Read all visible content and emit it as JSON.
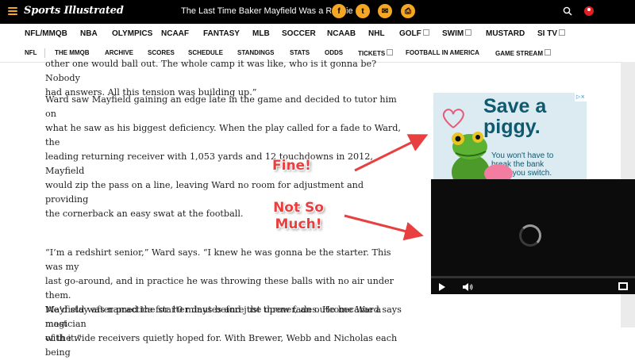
{
  "topbar": {
    "logo": "Sports Illustrated",
    "headline": "The Last Time Baker Mayfield Was a Rookie",
    "share_icons": [
      "facebook-icon",
      "twitter-icon",
      "email-icon",
      "print-icon"
    ],
    "share_glyphs": [
      "f",
      "t",
      "✉",
      "⎙"
    ]
  },
  "nav_primary": [
    {
      "label": "NFL/MMQB"
    },
    {
      "label": "NBA"
    },
    {
      "label": "OLYMPICS"
    },
    {
      "label": "NCAAF"
    },
    {
      "label": "FANTASY"
    },
    {
      "label": "MLB"
    },
    {
      "label": "SOCCER"
    },
    {
      "label": "NCAAB"
    },
    {
      "label": "NHL"
    },
    {
      "label": "GOLF"
    },
    {
      "label": "SWIM"
    },
    {
      "label": "MUSTARD"
    },
    {
      "label": "SI TV"
    }
  ],
  "nav_secondary": [
    {
      "label": "NFL"
    },
    {
      "label": "THE MMQB"
    },
    {
      "label": "ARCHIVE"
    },
    {
      "label": "SCORES"
    },
    {
      "label": "SCHEDULE"
    },
    {
      "label": "STANDINGS"
    },
    {
      "label": "STATS"
    },
    {
      "label": "ODDS"
    },
    {
      "label": "TICKETS"
    },
    {
      "label": "FOOTBALL IN AMERICA"
    },
    {
      "label": "GAME STREAM"
    }
  ],
  "article": {
    "p0_lines": [
      "other one would ball out. The whole camp it was like, who is it gonna be? Nobody",
      "had answers. All this tension was building up.”"
    ],
    "p1_lines": [
      "Ward saw Mayfield gaining an edge late in the game and decided to tutor him on",
      "what he saw as his biggest deficiency. When the play called for a fade to Ward, the",
      "leading returning receiver with 1,053 yards and 12 touchdowns in 2012, Mayfield",
      "would zip the pass on a line, leaving Ward no room for adjustment and providing",
      "the cornerback an easy swat at the football."
    ],
    "p2_lines": [
      "“I’m a redshirt senior,” Ward says. “I knew he was gonna be the starter. This was my",
      "last go-around, and in practice he was throwing these balls with no air under them.",
      "We’d stay after practice for 10 minutes and just throw fades. He became a magician",
      "with it.”"
    ],
    "p3_lines": [
      "Mayfield was named the starter days before the opener, an outcome Ward says most",
      "of the wide receivers quietly hoped for. With Brewer, Webb and Nicholas each being"
    ]
  },
  "ad": {
    "title_line1": "Save a",
    "title_line2": "piggy.",
    "sub_lines": [
      "You won't have to",
      "break the bank",
      "when you switch."
    ],
    "adchoices_label": "▷×"
  },
  "video_player": {
    "state": "loading"
  },
  "annotations": {
    "fine": "Fine!",
    "not_so": "Not So",
    "much": "Much!"
  },
  "colors": {
    "accent": "#f5a623",
    "annotation_red": "#e84040",
    "ad_teal": "#0d5a70"
  }
}
